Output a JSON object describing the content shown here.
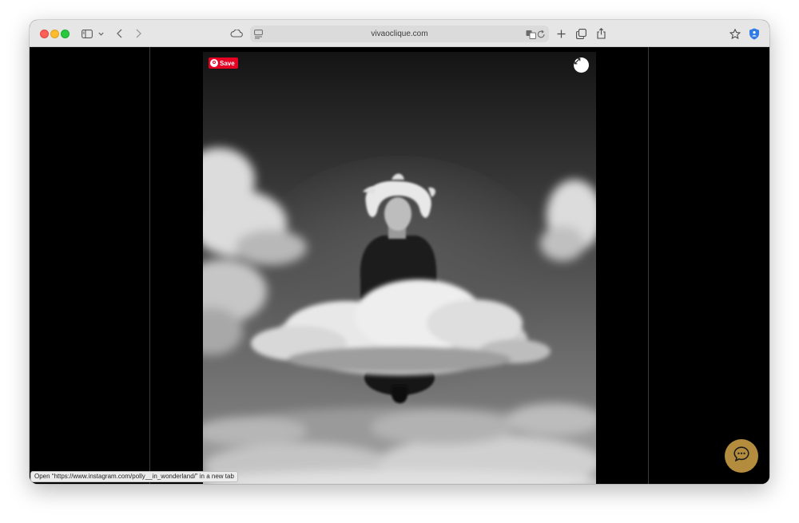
{
  "browser": {
    "url": "vivaoclique.com",
    "status_text": "Open “https://www.instagram.com/polly__in_wonderland/” in a new tab",
    "icons": [
      "sidebar-icon",
      "chevron-down-icon",
      "back-icon",
      "forward-icon",
      "icloud-icon",
      "page-menu-icon",
      "translate-icon",
      "reload-icon",
      "new-tab-icon",
      "tab-overview-icon",
      "share-icon",
      "bookmark-star-icon",
      "extension-shield-icon"
    ]
  },
  "photo": {
    "save_label": "Save",
    "icons": [
      "pinterest-icon",
      "expand-icon"
    ]
  },
  "chat": {
    "icon": "chat-bubble-icon",
    "color": "#b48c3e"
  },
  "colors": {
    "save_red": "#e60023",
    "page_bg": "#000000",
    "toolbar_bg": "#e7e6e7"
  }
}
